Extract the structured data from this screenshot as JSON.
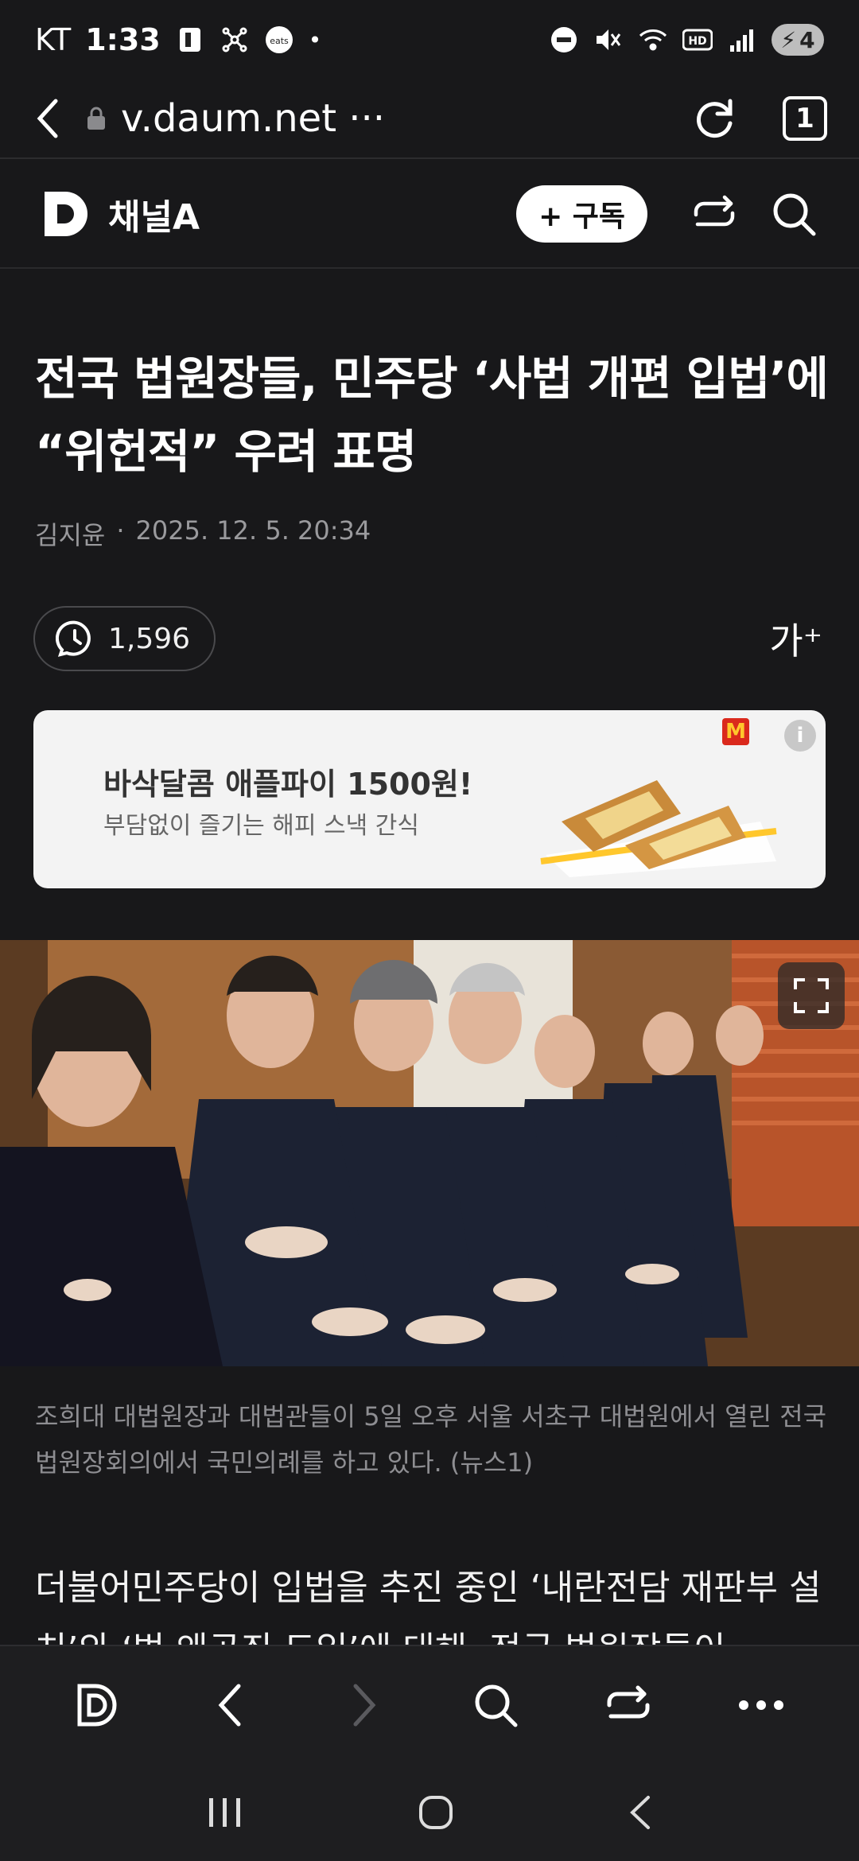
{
  "status": {
    "carrier": "KT",
    "time": "1:33",
    "battery": "4"
  },
  "browser": {
    "url": "v.daum.net ···",
    "tab_count": "1"
  },
  "site": {
    "brand": "채널A",
    "subscribe_label": "+ 구독"
  },
  "article": {
    "title": "전국 법원장들, 민주당 ‘사법 개편 입법’에 “위헌적” 우려 표명",
    "author": "김지윤",
    "separator": "·",
    "date": "2025. 12. 5. 20:34",
    "views": "1,596",
    "font_size_label": "가⁺",
    "caption": "조희대 대법원장과 대법관들이 5일 오후 서울 서초구 대법원에서 열린 전국법원장회의에서 국민의례를 하고 있다. (뉴스1)",
    "body_start": "더불어민주당이 입법을 추진 중인 ‘내란전담 재판부 설치’와 ‘법 왜곡죄 도입’에 대해, 전국 법원장들이"
  },
  "ad": {
    "headline": "바삭달콤 애플파이 1500원!",
    "subline": "부담없이 즐기는 해피 스낵 간식",
    "brand_mark": "M",
    "info_label": "i"
  },
  "colors": {
    "background": "#18181a",
    "ad_background": "#f3f3f3",
    "mcd_red": "#da291c",
    "mcd_yellow": "#ffc72c"
  }
}
